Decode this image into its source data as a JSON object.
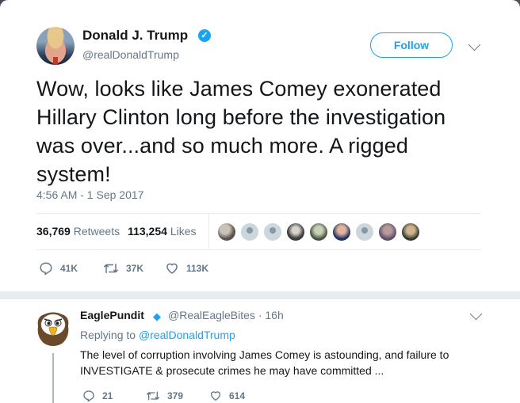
{
  "tweet": {
    "author_name": "Donald J. Trump",
    "verified_mark": "✓",
    "handle": "@realDonaldTrump",
    "follow_label": "Follow",
    "text": "Wow, looks like James Comey exonerated Hillary Clinton long before the investigation was over...and so much more. A rigged system!",
    "timestamp": "4:56 AM - 1 Sep 2017",
    "retweets_count": "36,769",
    "retweets_label": "Retweets",
    "likes_count": "113,254",
    "likes_label": "Likes",
    "actions": {
      "reply_count": "41K",
      "retweet_count": "37K",
      "like_count": "113K"
    }
  },
  "reply": {
    "author_name": "EaglePundit",
    "badge": "◆",
    "handle": "@RealEagleBites",
    "separator": "·",
    "time": "16h",
    "replying_prefix": "Replying to",
    "replying_handle": "@realDonaldTrump",
    "text": "The level of corruption involving James Comey is astounding, and failure to INVESTIGATE & prosecute crimes he may have committed ...",
    "actions": {
      "reply_count": "21",
      "retweet_count": "379",
      "like_count": "614"
    }
  },
  "colors": {
    "accent": "#1da1f2",
    "secondary_text": "#657786",
    "primary_text": "#14171a",
    "divider": "#e6ecf0"
  },
  "icons": [
    "verified-badge-icon",
    "chevron-down-icon",
    "reply-icon",
    "retweet-icon",
    "heart-icon",
    "eagle-avatar"
  ]
}
